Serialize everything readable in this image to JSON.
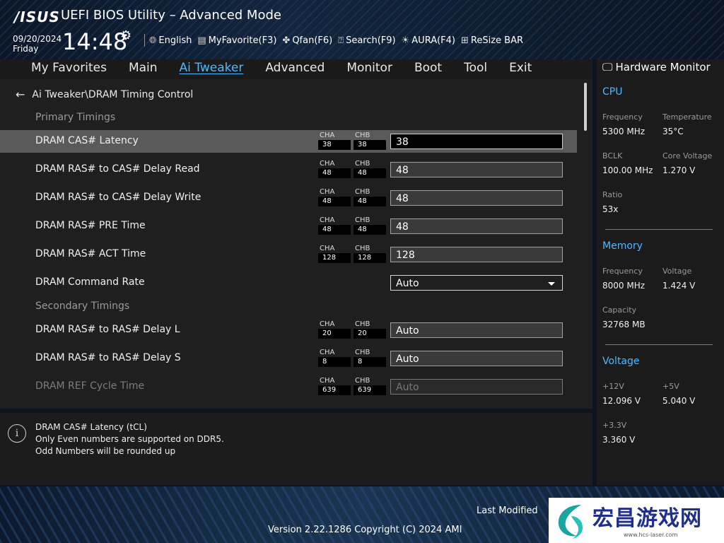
{
  "header": {
    "logo": "/ISUS",
    "title": "UEFI BIOS Utility – Advanced Mode",
    "date": "09/20/2024",
    "day": "Friday",
    "time": "14:48",
    "toolbar": [
      {
        "icon": "globe-icon",
        "label": "English"
      },
      {
        "icon": "myfavorite-icon",
        "label": "MyFavorite(F3)"
      },
      {
        "icon": "fan-icon",
        "label": "Qfan(F6)"
      },
      {
        "icon": "help-search-icon",
        "label": "Search(F9)"
      },
      {
        "icon": "aura-icon",
        "label": "AURA(F4)"
      },
      {
        "icon": "resize-bar-icon",
        "label": "ReSize BAR"
      }
    ]
  },
  "menu": {
    "tabs": [
      "My Favorites",
      "Main",
      "Ai Tweaker",
      "Advanced",
      "Monitor",
      "Boot",
      "Tool",
      "Exit"
    ],
    "active": "Ai Tweaker"
  },
  "breadcrumb": "Ai Tweaker\\DRAM Timing Control",
  "sections": {
    "primary": "Primary Timings",
    "secondary": "Secondary Timings"
  },
  "channel_labels": {
    "a": "CHA",
    "b": "CHB"
  },
  "rows": [
    {
      "label": "DRAM CAS# Latency",
      "cha": "38",
      "chb": "38",
      "value": "38"
    },
    {
      "label": "DRAM RAS# to CAS# Delay Read",
      "cha": "48",
      "chb": "48",
      "value": "48"
    },
    {
      "label": "DRAM RAS# to CAS# Delay Write",
      "cha": "48",
      "chb": "48",
      "value": "48"
    },
    {
      "label": "DRAM RAS# PRE Time",
      "cha": "48",
      "chb": "48",
      "value": "48"
    },
    {
      "label": "DRAM RAS# ACT Time",
      "cha": "128",
      "chb": "128",
      "value": "128"
    },
    {
      "label": "DRAM Command Rate",
      "value": "Auto"
    },
    {
      "label": "DRAM RAS# to RAS# Delay L",
      "cha": "20",
      "chb": "20",
      "value": "Auto"
    },
    {
      "label": "DRAM RAS# to RAS# Delay S",
      "cha": "8",
      "chb": "8",
      "value": "Auto"
    },
    {
      "label": "DRAM REF Cycle Time",
      "cha": "639",
      "chb": "639",
      "value": "Auto"
    }
  ],
  "help": {
    "line1": "DRAM CAS# Latency (tCL)",
    "line2": "Only Even numbers are supported on DDR5.",
    "line3": "Odd Numbers will be rounded up"
  },
  "hardware_monitor": {
    "title": "Hardware Monitor",
    "cpu": {
      "heading": "CPU",
      "frequency_label": "Frequency",
      "frequency": "5300 MHz",
      "temperature_label": "Temperature",
      "temperature": "35°C",
      "bclk_label": "BCLK",
      "bclk": "100.00 MHz",
      "core_voltage_label": "Core Voltage",
      "core_voltage": "1.270 V",
      "ratio_label": "Ratio",
      "ratio": "53x"
    },
    "memory": {
      "heading": "Memory",
      "frequency_label": "Frequency",
      "frequency": "8000 MHz",
      "voltage_label": "Voltage",
      "voltage": "1.424 V",
      "capacity_label": "Capacity",
      "capacity": "32768 MB"
    },
    "voltage": {
      "heading": "Voltage",
      "v12_label": "+12V",
      "v12": "12.096 V",
      "v5_label": "+5V",
      "v5": "5.040 V",
      "v33_label": "+3.3V",
      "v33": "3.360 V"
    }
  },
  "footer": {
    "last_modified": "Last Modified",
    "version": "Version 2.22.1286 Copyright (C) 2024 AMI"
  },
  "watermark": {
    "text": "宏昌游戏网",
    "url": "www.hcs-laser.com"
  },
  "colors": {
    "accent": "#4fb8ff",
    "selected_row": "#5a5a5a",
    "panel": "#1f1f1f"
  }
}
